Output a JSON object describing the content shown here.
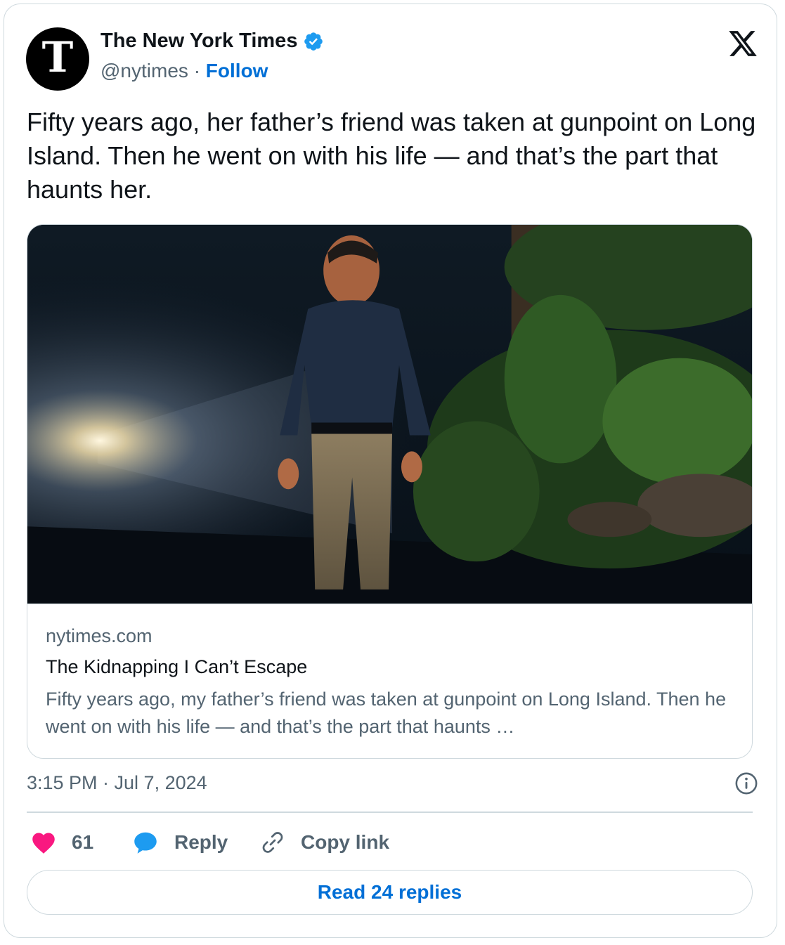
{
  "author": {
    "name": "The New York Times",
    "handle": "@nytimes",
    "separator": "·",
    "follow_label": "Follow",
    "avatar_glyph": "T",
    "verified_color": "#1d9bf0"
  },
  "tweet": {
    "text": "Fifty years ago, her father’s friend was taken at gunpoint on Long Island. Then he went on with his life — and that’s the part that haunts her."
  },
  "link_card": {
    "domain": "nytimes.com",
    "title": "The Kidnapping I Can’t Escape",
    "description": "Fifty years ago, my father’s friend was taken at gunpoint on Long Island. Then he went on with his life — and that’s the part that haunts …",
    "image_subject": "older man in dark shirt and khaki trousers standing on a road at night, headlight glare at left, foliage at right"
  },
  "meta": {
    "timestamp": "3:15 PM · Jul 7, 2024"
  },
  "actions": {
    "like_count": "61",
    "reply_label": "Reply",
    "copy_label": "Copy link",
    "read_replies_label": "Read 24 replies"
  },
  "colors": {
    "link_blue": "#006fd6",
    "like_pink": "#f91880",
    "reply_blue": "#1d9bf0",
    "muted_text": "#536471",
    "border": "#cfd9de"
  },
  "icons": [
    "nyt-logo-icon",
    "verified-badge-icon",
    "x-logo-icon",
    "info-icon",
    "heart-icon",
    "reply-bubble-icon",
    "link-icon"
  ]
}
